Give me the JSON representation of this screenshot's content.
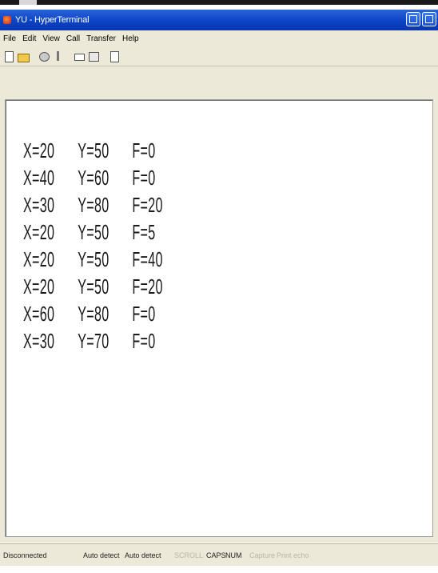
{
  "window": {
    "title": "YU - HyperTerminal"
  },
  "menu": {
    "items": [
      "File",
      "Edit",
      "View",
      "Call",
      "Transfer",
      "Help"
    ]
  },
  "toolbar": {
    "icons": [
      "new-icon",
      "open-icon",
      "connect-icon",
      "disconnect-icon",
      "send-icon",
      "receive-icon",
      "properties-icon"
    ]
  },
  "terminal": {
    "rows": [
      {
        "x": "X=20",
        "y": "Y=50",
        "f": "F=0"
      },
      {
        "x": "X=40",
        "y": "Y=60",
        "f": "F=0"
      },
      {
        "x": "X=30",
        "y": "Y=80",
        "f": "F=20"
      },
      {
        "x": "X=20",
        "y": "Y=50",
        "f": "F=5"
      },
      {
        "x": "X=20",
        "y": "Y=50",
        "f": "F=40"
      },
      {
        "x": "X=20",
        "y": "Y=50",
        "f": "F=20"
      },
      {
        "x": "X=60",
        "y": "Y=80",
        "f": "F=0"
      },
      {
        "x": "X=30",
        "y": "Y=70",
        "f": "F=0"
      }
    ]
  },
  "status": {
    "connection": "Disconnected",
    "detect1": "Auto detect",
    "detect2": "Auto detect",
    "scroll": "SCROLL",
    "caps": "CAPS",
    "num": "NUM",
    "capture": "Capture",
    "print_echo": "Print echo"
  }
}
